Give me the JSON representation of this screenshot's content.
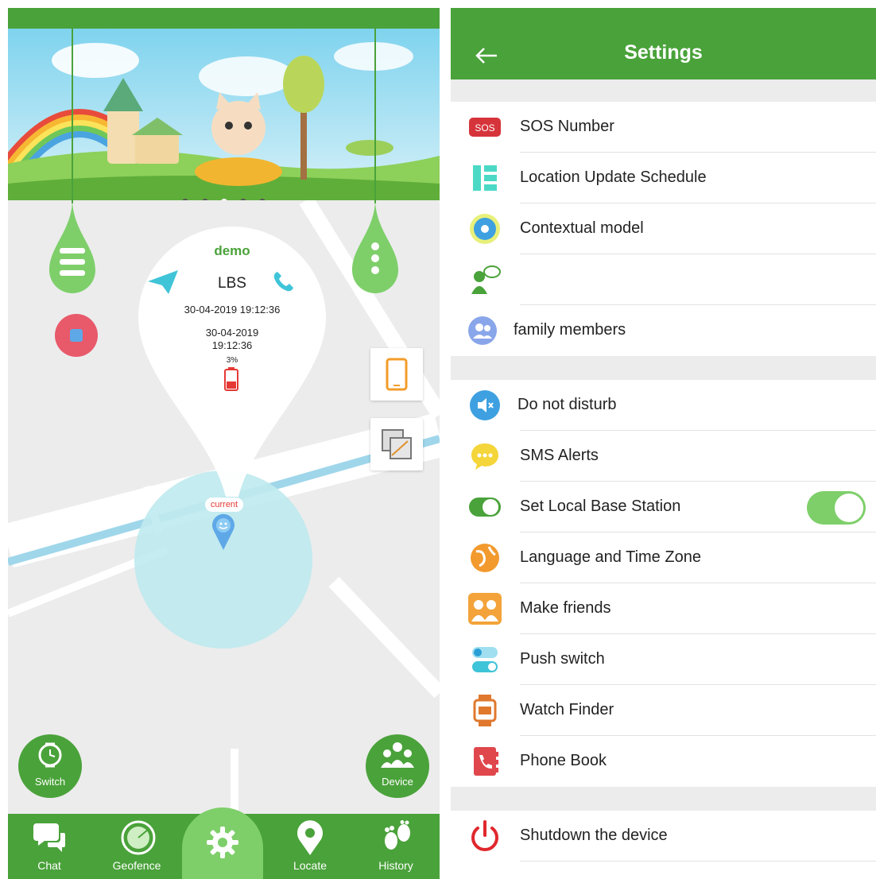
{
  "left_phone": {
    "callout": {
      "name": "demo",
      "source": "LBS",
      "time1": "30-04-2019 19:12:36",
      "time2_date": "30-04-2019",
      "time2_time": "19:12:36",
      "battery": "3%"
    },
    "marker_label": "current",
    "switch_label": "Switch",
    "device_label": "Device",
    "tabs": [
      "Chat",
      "Geofence",
      "Locate",
      "History"
    ],
    "colors": {
      "primary": "#4aa23a",
      "accent_light": "#7ecf6a",
      "teal": "#40c4d8"
    }
  },
  "right_phone": {
    "title": "Settings",
    "group1": [
      {
        "label": "SOS Number",
        "icon": "sos-icon"
      },
      {
        "label": "Location Update Schedule",
        "icon": "schedule-icon"
      },
      {
        "label": "Contextual model",
        "icon": "contextual-icon"
      },
      {
        "label": "",
        "icon": "contact-icon"
      },
      {
        "label": "family members",
        "icon": "family-icon"
      }
    ],
    "group2": [
      {
        "label": "Do not disturb",
        "icon": "mute-icon"
      },
      {
        "label": "SMS Alerts",
        "icon": "sms-icon"
      },
      {
        "label": "Set Local Base Station",
        "icon": "base-station-icon",
        "toggle": true
      },
      {
        "label": "Language and Time Zone",
        "icon": "globe-icon"
      },
      {
        "label": "Make friends",
        "icon": "friends-icon"
      },
      {
        "label": "Push switch",
        "icon": "push-switch-icon"
      },
      {
        "label": "Watch Finder",
        "icon": "watch-icon"
      },
      {
        "label": "Phone Book",
        "icon": "phonebook-icon"
      }
    ],
    "group3": [
      {
        "label": "Shutdown the device",
        "icon": "power-icon"
      }
    ]
  }
}
